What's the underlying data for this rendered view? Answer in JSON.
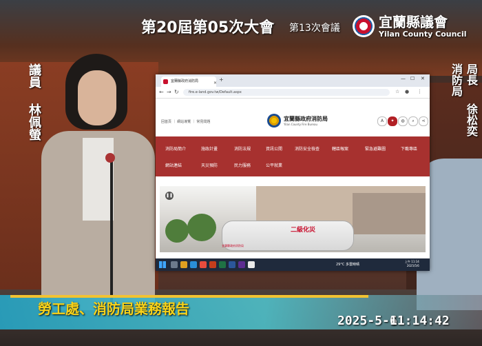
{
  "broadcast": {
    "session_title": "第20屆第05次大會",
    "meeting_number": "第13次會議",
    "council_name": "宜蘭縣議會",
    "council_name_en": "Yilan County Council",
    "speaker_role": "議員",
    "speaker_name": "林佩螢",
    "official_role_line1": "消防局",
    "official_role_line2": "局長",
    "official_name": "徐松奕",
    "topic": "勞工處、消防局業務報告",
    "date": "2025-5-6",
    "time": "11:14:42",
    "accent_colors": {
      "topic_text": "#f8d21a",
      "bar": "#28a0be",
      "menu_red": "#a7312f"
    }
  },
  "browser": {
    "tab_title": "宜蘭縣政府消防局",
    "address": "fire.e-land.gov.tw/Default.aspx",
    "site_name": "宜蘭縣政府消防局",
    "site_name_en": "Yilan County Fire Bureau",
    "top_links": "回首頁 ｜ 網站導覽 ｜ 常見問題",
    "header_icons": [
      "A-icon",
      "fire-icon",
      "globe-icon",
      "search-icon",
      "share-icon"
    ],
    "menu_row1": [
      "消防局簡介",
      "施政計畫",
      "消防法規",
      "資訊公開",
      "消防安全檢查",
      "轄區報案",
      "緊急避難圖",
      "下載專區"
    ],
    "menu_row2": [
      "網站連結",
      "天災預防",
      "民力服務",
      "公平就業"
    ],
    "banner_truck_text": "二級化災",
    "banner_truck_subtext": "宜蘭縣政府消防局",
    "taskbar_weather": "29°C 多雲時晴",
    "taskbar_time": "上午 11:14",
    "taskbar_date": "2025/5/6"
  }
}
